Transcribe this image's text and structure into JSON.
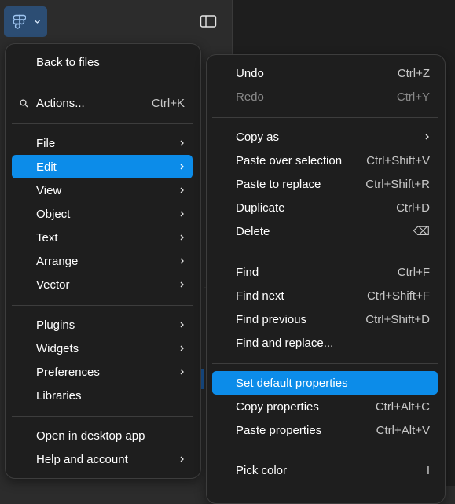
{
  "toolbar": {
    "logo_icon": "figma-logo-icon",
    "menu_chevron": "chevron-down-icon",
    "panel_icon": "sidebar-toggle-icon"
  },
  "main_menu": {
    "back": "Back to files",
    "actions": {
      "label": "Actions...",
      "shortcut": "Ctrl+K"
    },
    "file": "File",
    "edit": "Edit",
    "view": "View",
    "object": "Object",
    "text": "Text",
    "arrange": "Arrange",
    "vector": "Vector",
    "plugins": "Plugins",
    "widgets": "Widgets",
    "preferences": "Preferences",
    "libraries": "Libraries",
    "open_desktop": "Open in desktop app",
    "help": "Help and account"
  },
  "edit_menu": {
    "undo": {
      "label": "Undo",
      "shortcut": "Ctrl+Z"
    },
    "redo": {
      "label": "Redo",
      "shortcut": "Ctrl+Y"
    },
    "copy_as": {
      "label": "Copy as"
    },
    "paste_over": {
      "label": "Paste over selection",
      "shortcut": "Ctrl+Shift+V"
    },
    "paste_replace": {
      "label": "Paste to replace",
      "shortcut": "Ctrl+Shift+R"
    },
    "duplicate": {
      "label": "Duplicate",
      "shortcut": "Ctrl+D"
    },
    "delete": {
      "label": "Delete",
      "shortcut": "⌫"
    },
    "find": {
      "label": "Find",
      "shortcut": "Ctrl+F"
    },
    "find_next": {
      "label": "Find next",
      "shortcut": "Ctrl+Shift+F"
    },
    "find_prev": {
      "label": "Find previous",
      "shortcut": "Ctrl+Shift+D"
    },
    "find_replace": {
      "label": "Find and replace..."
    },
    "set_default": {
      "label": "Set default properties"
    },
    "copy_props": {
      "label": "Copy properties",
      "shortcut": "Ctrl+Alt+C"
    },
    "paste_props": {
      "label": "Paste properties",
      "shortcut": "Ctrl+Alt+V"
    },
    "pick_color": {
      "label": "Pick color",
      "shortcut": "I"
    }
  },
  "colors": {
    "accent": "#0c8ce9",
    "menu_bg": "#1e1e1e",
    "toolbar_bg": "#2c2c2c",
    "logo_bg": "#2c4d73"
  }
}
